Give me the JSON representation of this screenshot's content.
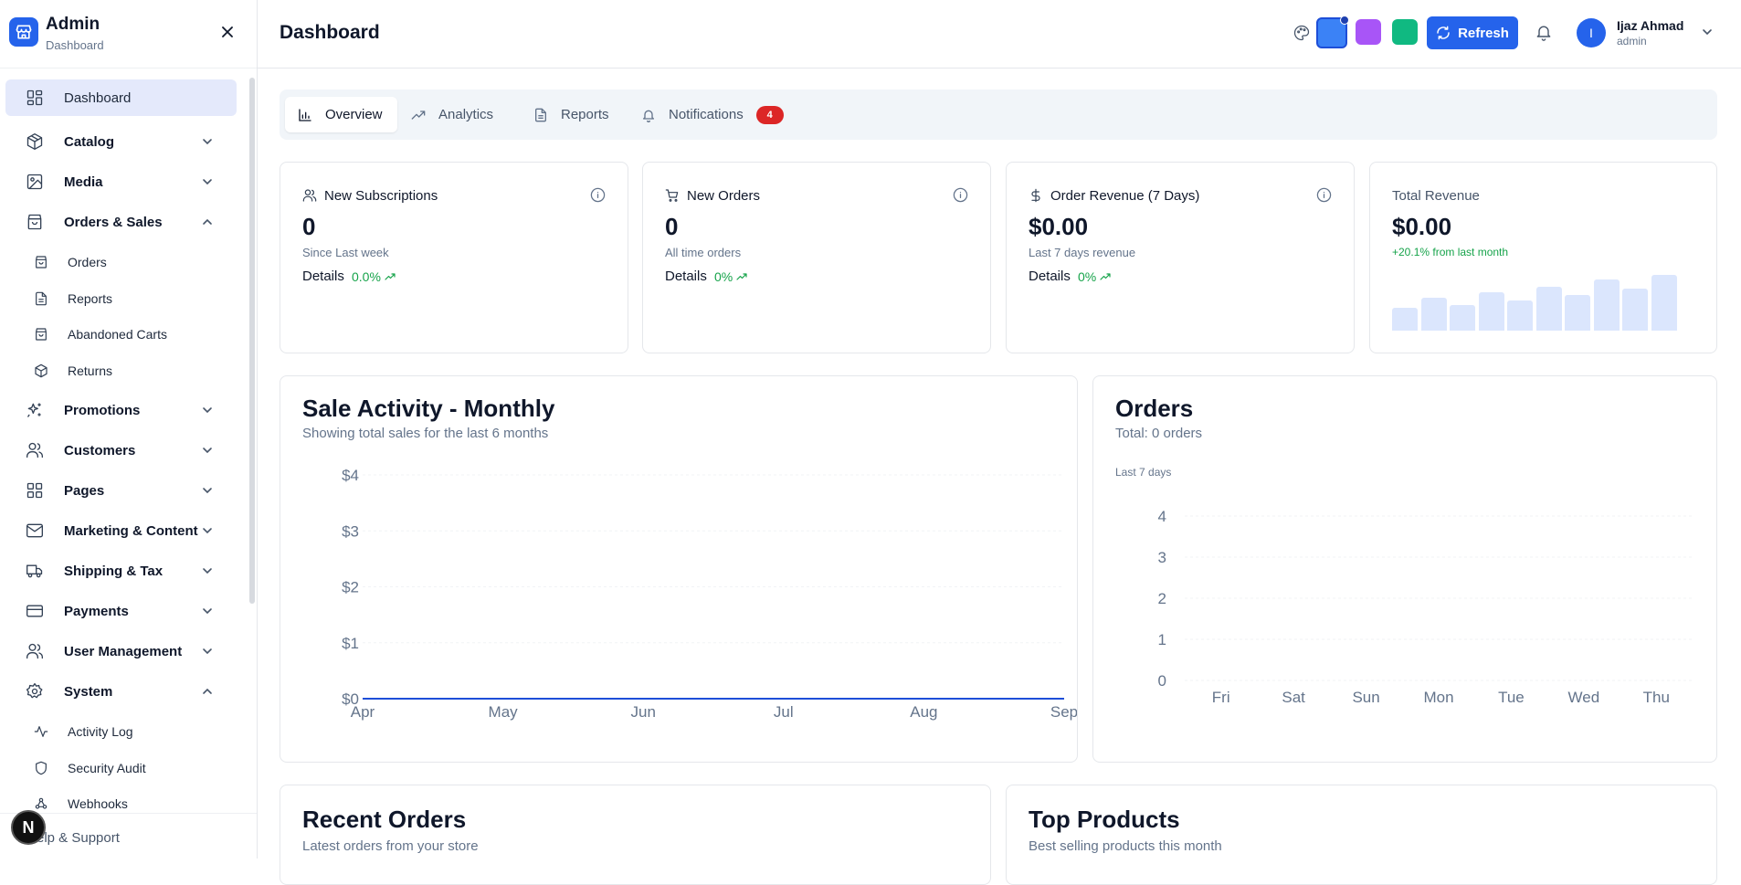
{
  "sidebar": {
    "brand_title": "Admin",
    "brand_subtitle": "Dashboard",
    "items": [
      {
        "label": "Dashboard",
        "icon": "grid-icon"
      },
      {
        "label": "Catalog",
        "icon": "box-icon"
      },
      {
        "label": "Media",
        "icon": "image-icon"
      },
      {
        "label": "Orders & Sales",
        "icon": "shopping-bag-icon"
      },
      {
        "label": "Orders",
        "icon": "shopping-bag-icon"
      },
      {
        "label": "Reports",
        "icon": "file-text-icon"
      },
      {
        "label": "Abandoned Carts",
        "icon": "shopping-bag-icon"
      },
      {
        "label": "Returns",
        "icon": "package-icon"
      },
      {
        "label": "Promotions",
        "icon": "sparkles-icon"
      },
      {
        "label": "Customers",
        "icon": "users-icon"
      },
      {
        "label": "Pages",
        "icon": "grid-icon"
      },
      {
        "label": "Marketing & Content",
        "icon": "mail-icon"
      },
      {
        "label": "Shipping & Tax",
        "icon": "truck-icon"
      },
      {
        "label": "Payments",
        "icon": "credit-card-icon"
      },
      {
        "label": "User Management",
        "icon": "users-icon"
      },
      {
        "label": "System",
        "icon": "gear-icon"
      },
      {
        "label": "Activity Log",
        "icon": "activity-icon"
      },
      {
        "label": "Security Audit",
        "icon": "shield-icon"
      },
      {
        "label": "Webhooks",
        "icon": "webhook-icon"
      }
    ],
    "footer_label": "elp & Support",
    "fab_letter": "N"
  },
  "header": {
    "title": "Dashboard",
    "theme_colors": [
      "#3b82f6",
      "#a855f7",
      "#10b981"
    ],
    "refresh_label": "Refresh",
    "user_initial": "I",
    "user_name": "Ijaz Ahmad",
    "user_role": "admin"
  },
  "tabs": [
    {
      "label": "Overview",
      "icon": "bar-chart-icon"
    },
    {
      "label": "Analytics",
      "icon": "trending-up-icon"
    },
    {
      "label": "Reports",
      "icon": "file-text-icon"
    },
    {
      "label": "Notifications",
      "icon": "bell-icon",
      "badge": "4"
    }
  ],
  "stats": [
    {
      "title": "New Subscriptions",
      "value": "0",
      "subtitle": "Since Last week",
      "details_label": "Details",
      "pct": "0.0%"
    },
    {
      "title": "New Orders",
      "value": "0",
      "subtitle": "All time orders",
      "details_label": "Details",
      "pct": "0%"
    },
    {
      "title": "Order Revenue (7 Days)",
      "value": "$0.00",
      "subtitle": "Last 7 days revenue",
      "details_label": "Details",
      "pct": "0%"
    }
  ],
  "total_revenue": {
    "title": "Total Revenue",
    "value": "$0.00",
    "change": "+20.1% from last month",
    "bar_levels": [
      0.4,
      0.58,
      0.45,
      0.67,
      0.54,
      0.78,
      0.63,
      0.9,
      0.74,
      0.98
    ]
  },
  "sales_chart": {
    "title": "Sale Activity - Monthly",
    "subtitle": "Showing total sales for the last 6 months"
  },
  "orders_chart": {
    "title": "Orders",
    "subtitle": "Total: 0 orders",
    "note": "Last 7 days"
  },
  "recent_orders": {
    "title": "Recent Orders",
    "subtitle": "Latest orders from your store"
  },
  "top_products": {
    "title": "Top Products",
    "subtitle": "Best selling products this month"
  },
  "chart_data": [
    {
      "type": "line",
      "x": [
        "Apr",
        "May",
        "Jun",
        "Jul",
        "Aug",
        "Sep"
      ],
      "y_ticks": [
        "$0",
        "$1",
        "$2",
        "$3",
        "$4"
      ],
      "ylim": [
        0,
        4
      ],
      "series": [
        {
          "values": [
            0,
            0,
            0,
            0,
            0,
            0
          ]
        }
      ],
      "grid": true,
      "color": "#1d4ed8"
    },
    {
      "type": "bar",
      "categories": [
        "Fri",
        "Sat",
        "Sun",
        "Mon",
        "Tue",
        "Wed",
        "Thu"
      ],
      "y_ticks": [
        "0",
        "1",
        "2",
        "3",
        "4"
      ],
      "ylim": [
        0,
        4
      ],
      "values": [
        0,
        0,
        0,
        0,
        0,
        0,
        0
      ],
      "grid": true
    }
  ]
}
